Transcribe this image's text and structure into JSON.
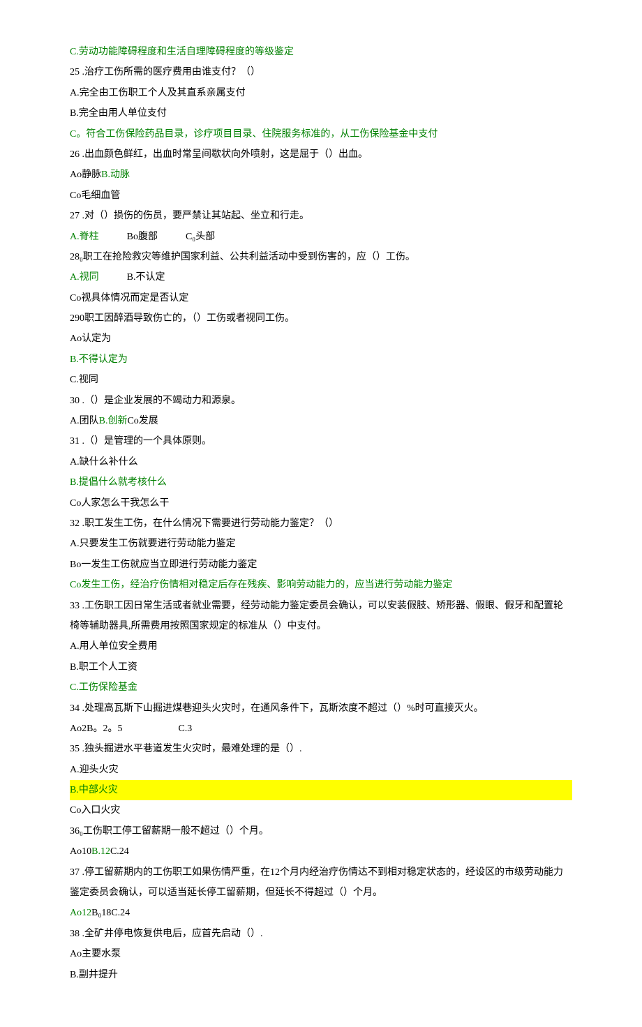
{
  "lines": [
    {
      "text": "C.劳动功能障碍程度和生活自理障碍程度的等级鉴定",
      "cls": "green"
    },
    {
      "text": "25  .治疗工伤所需的医疗费用由谁支付？（）"
    },
    {
      "text": "A.完全由工伤职工个人及其直系亲属支付"
    },
    {
      "text": "B.完全由用人单位支付"
    },
    {
      "text": "C。符合工伤保险药品目录，诊疗项目目录、住院服务标准的，从工伤保险基金中支付",
      "cls": "green"
    },
    {
      "text": "26  .出血颜色鲜红，出血时常呈间歇状向外喷射，这是屈于（）出血。"
    },
    {
      "html": "Ao静脉<span class='inline-green'>B.动脉</span>"
    },
    {
      "text": "Co毛细血管"
    },
    {
      "text": "27  .对（）损伤的伤员，要严禁让其站起、坐立和行走。"
    },
    {
      "html": "<span class='inline-green'>A.脊柱</span><span class='gap'></span>Bo腹部<span class='gap'></span>C₀头部"
    },
    {
      "text": "28₀职工在抢险救灾等维护国家利益、公共利益活动中受到伤害的，应（）工伤。"
    },
    {
      "html": "<span class='inline-green'>A.视同</span><span class='gap'></span>B.不认定"
    },
    {
      "text": "Co视具体情况而定是否认定"
    },
    {
      "text": "290职工因醉酒导致伤亡的，（）工伤或者视同工伤。"
    },
    {
      "text": "Ao认定为"
    },
    {
      "text": "B.不得认定为",
      "cls": "green"
    },
    {
      "text": "C.视同"
    },
    {
      "text": "30  .（）是企业发展的不竭动力和源泉。"
    },
    {
      "html": "A.团队<span class='inline-green'>B.创新</span>Co发展"
    },
    {
      "text": "31  .（）是管理的一个具体原则。"
    },
    {
      "text": "A.缺什么补什么"
    },
    {
      "text": "B.提倡什么就考核什么",
      "cls": "green"
    },
    {
      "text": "Co人家怎么干我怎么干"
    },
    {
      "text": "32  .职工发生工伤，在什么情况下需要进行劳动能力鉴定？（）"
    },
    {
      "text": "A.只要发生工伤就要进行劳动能力鉴定"
    },
    {
      "text": "Bo一发生工伤就应当立即进行劳动能力鉴定"
    },
    {
      "text": "Co发生工伤，经治疗伤情相对稳定后存在残疾、影响劳动能力的，应当进行劳动能力鉴定",
      "cls": "green"
    },
    {
      "text": "33  .工伤职工因日常生活或者就业需要，经劳动能力鉴定委员会确认，可以安装假肢、矫形器、假眼、假牙和配置轮椅等辅助器具,所需费用按照国家规定的标准从（）中支付。"
    },
    {
      "text": "A.用人单位安全费用"
    },
    {
      "text": "B.职工个人工资"
    },
    {
      "text": "C.工伤保险基金",
      "cls": "green"
    },
    {
      "text": "34  .处理高瓦斯下山掘进煤巷迎头火灾时，在通风条件下，瓦斯浓度不超过（）%时可直接灭火。"
    },
    {
      "html": "Ao2B。2。5<span class='gap'></span><span class='gap'></span>C.3"
    },
    {
      "text": "35  .独头掘进水平巷道发生火灾时，最难处理的是（）."
    },
    {
      "text": "A.迎头火灾"
    },
    {
      "text": "B.中部火灾",
      "cls": "hl-yellow green"
    },
    {
      "text": "Co入口火灾"
    },
    {
      "text": "36₀工伤职工停工留薪期一般不超过（）个月。"
    },
    {
      "html": "Ao10<span class='inline-green'>B.12</span>C.24"
    },
    {
      "text": "37  .停工留薪期内的工伤职工如果伤情严重，在12个月内经治疗伤情达不到相对稳定状态的，经设区的市级劳动能力鉴定委员会确认，可以适当延长停工留薪期，但延长不得超过（）个月。"
    },
    {
      "html": "<span class='inline-green'>Ao12</span>B₀18C.24"
    },
    {
      "text": "38  .全矿井停电恢复供电后，应首先启动（）."
    },
    {
      "text": "Ao主要水泵"
    },
    {
      "text": "B.副井提升"
    }
  ]
}
